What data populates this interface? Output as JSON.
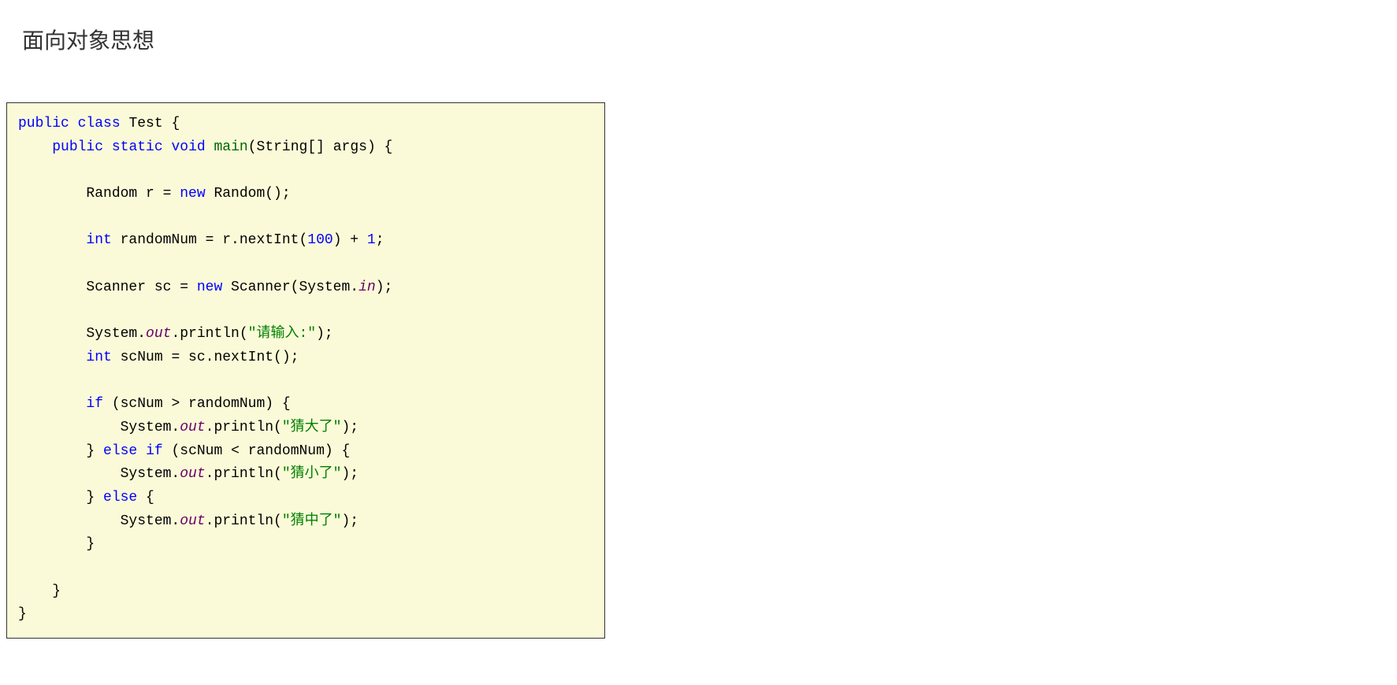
{
  "title": "面向对象思想",
  "code": {
    "tokens": [
      {
        "t": "public",
        "c": "kw"
      },
      {
        "t": " "
      },
      {
        "t": "class",
        "c": "kw"
      },
      {
        "t": " Test {\n    "
      },
      {
        "t": "public",
        "c": "kw"
      },
      {
        "t": " "
      },
      {
        "t": "static",
        "c": "kw"
      },
      {
        "t": " "
      },
      {
        "t": "void",
        "c": "kw"
      },
      {
        "t": " "
      },
      {
        "t": "main",
        "c": "fn"
      },
      {
        "t": "(String[] args) {\n\n        Random r = "
      },
      {
        "t": "new",
        "c": "kw"
      },
      {
        "t": " Random();\n\n        "
      },
      {
        "t": "int",
        "c": "kw"
      },
      {
        "t": " randomNum = r.nextInt("
      },
      {
        "t": "100",
        "c": "num"
      },
      {
        "t": ") + "
      },
      {
        "t": "1",
        "c": "num"
      },
      {
        "t": ";\n\n        Scanner sc = "
      },
      {
        "t": "new",
        "c": "kw"
      },
      {
        "t": " Scanner(System."
      },
      {
        "t": "in",
        "c": "it"
      },
      {
        "t": ");\n\n        System."
      },
      {
        "t": "out",
        "c": "it"
      },
      {
        "t": ".println("
      },
      {
        "t": "\"请输入:\"",
        "c": "str"
      },
      {
        "t": ");\n        "
      },
      {
        "t": "int",
        "c": "kw"
      },
      {
        "t": " scNum = sc.nextInt();\n\n        "
      },
      {
        "t": "if",
        "c": "kw"
      },
      {
        "t": " (scNum > randomNum) {\n            System."
      },
      {
        "t": "out",
        "c": "it"
      },
      {
        "t": ".println("
      },
      {
        "t": "\"猜大了\"",
        "c": "str"
      },
      {
        "t": ");\n        } "
      },
      {
        "t": "else",
        "c": "kw"
      },
      {
        "t": " "
      },
      {
        "t": "if",
        "c": "kw"
      },
      {
        "t": " (scNum < randomNum) {\n            System."
      },
      {
        "t": "out",
        "c": "it"
      },
      {
        "t": ".println("
      },
      {
        "t": "\"猜小了\"",
        "c": "str"
      },
      {
        "t": ");\n        } "
      },
      {
        "t": "else",
        "c": "kw"
      },
      {
        "t": " {\n            System."
      },
      {
        "t": "out",
        "c": "it"
      },
      {
        "t": ".println("
      },
      {
        "t": "\"猜中了\"",
        "c": "str"
      },
      {
        "t": ");\n        }\n\n    }\n}"
      }
    ]
  }
}
